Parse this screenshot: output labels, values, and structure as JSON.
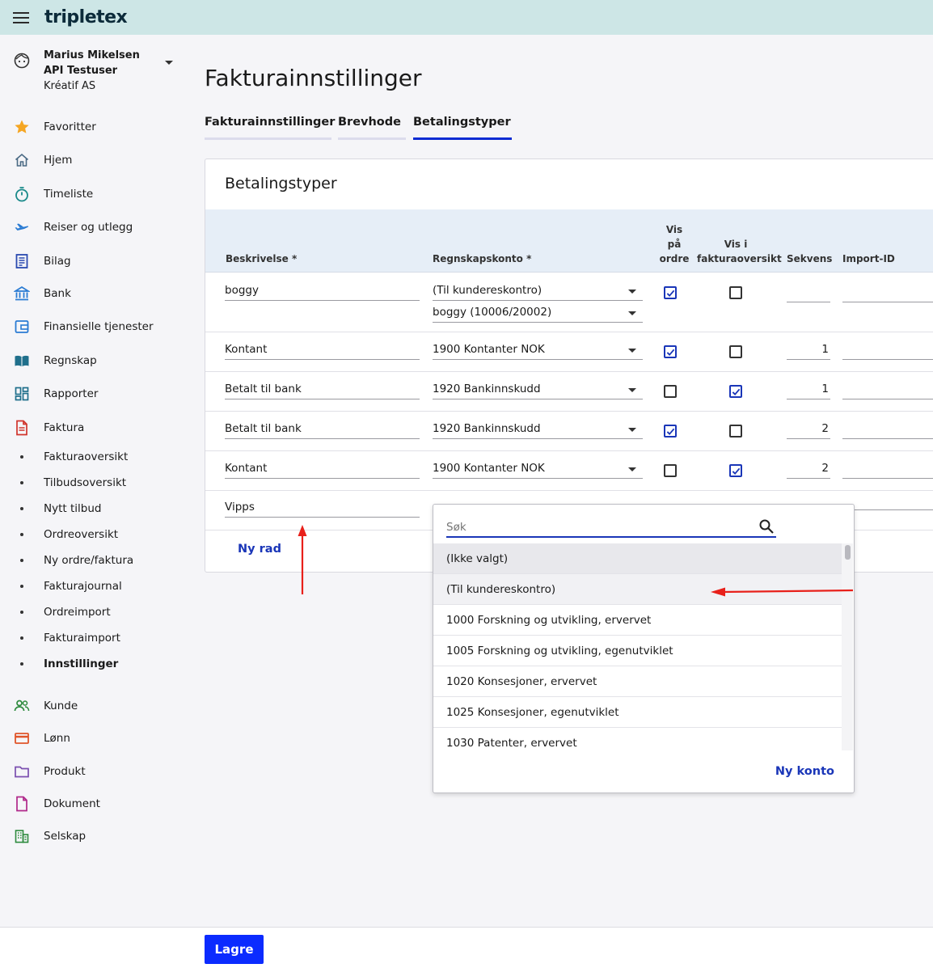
{
  "app": {
    "logo": "tripletex"
  },
  "user": {
    "name": "Marius Mikelsen API Testuser",
    "company": "Kréatif AS"
  },
  "nav": {
    "items": [
      {
        "label": "Favoritter",
        "icon": "star-icon"
      },
      {
        "label": "Hjem",
        "icon": "home-icon"
      },
      {
        "label": "Timeliste",
        "icon": "stopwatch-icon"
      },
      {
        "label": "Reiser og utlegg",
        "icon": "airplane-icon"
      },
      {
        "label": "Bilag",
        "icon": "receipt-icon"
      },
      {
        "label": "Bank",
        "icon": "bank-icon"
      },
      {
        "label": "Finansielle tjenester",
        "icon": "wallet-icon"
      },
      {
        "label": "Regnskap",
        "icon": "book-icon"
      },
      {
        "label": "Rapporter",
        "icon": "dashboard-icon"
      },
      {
        "label": "Faktura",
        "icon": "invoice-icon"
      }
    ],
    "sub_items": [
      {
        "label": "Fakturaoversikt"
      },
      {
        "label": "Tilbudsoversikt"
      },
      {
        "label": "Nytt tilbud"
      },
      {
        "label": "Ordreoversikt"
      },
      {
        "label": "Ny ordre/faktura"
      },
      {
        "label": "Fakturajournal"
      },
      {
        "label": "Ordreimport"
      },
      {
        "label": "Fakturaimport"
      },
      {
        "label": "Innstillinger",
        "active": true
      }
    ],
    "items2": [
      {
        "label": "Kunde",
        "icon": "people-icon"
      },
      {
        "label": "Lønn",
        "icon": "card-icon"
      },
      {
        "label": "Produkt",
        "icon": "folder-icon"
      },
      {
        "label": "Dokument",
        "icon": "document-icon"
      },
      {
        "label": "Selskap",
        "icon": "building-icon"
      }
    ]
  },
  "page": {
    "title": "Fakturainnstillinger",
    "tabs": [
      {
        "label": "Fakturainnstillinger"
      },
      {
        "label": "Brevhode"
      },
      {
        "label": "Betalingstyper",
        "active": true
      }
    ]
  },
  "card": {
    "title": "Betalingstyper",
    "headers": {
      "description": "Beskrivelse *",
      "account": "Regnskapskonto *",
      "show_order": [
        "Vis",
        "på",
        "ordre"
      ],
      "show_invoice": [
        "Vis i",
        "fakturaoversikt"
      ],
      "sequence": "Sekvens",
      "import_id": "Import-ID"
    },
    "rows": [
      {
        "description": "boggy",
        "account": "(Til kundereskontro)",
        "subaccount": "boggy (10006/20002)",
        "show_order": true,
        "show_invoice": false,
        "sequence": ""
      },
      {
        "description": "Kontant",
        "account": "1900 Kontanter NOK",
        "show_order": true,
        "show_invoice": false,
        "sequence": "1"
      },
      {
        "description": "Betalt til bank",
        "account": "1920 Bankinnskudd",
        "show_order": false,
        "show_invoice": true,
        "sequence": "1"
      },
      {
        "description": "Betalt til bank",
        "account": "1920 Bankinnskudd",
        "show_order": true,
        "show_invoice": false,
        "sequence": "2"
      },
      {
        "description": "Kontant",
        "account": "1900 Kontanter NOK",
        "show_order": false,
        "show_invoice": true,
        "sequence": "2"
      },
      {
        "description": "Vipps"
      }
    ],
    "new_row": "Ny rad"
  },
  "dropdown": {
    "search_placeholder": "Søk",
    "options": [
      "(Ikke valgt)",
      "(Til kundereskontro)",
      "1000 Forskning og utvikling, ervervet",
      "1005 Forskning og utvikling, egenutviklet",
      "1020 Konsesjoner, ervervet",
      "1025 Konsesjoner, egenutviklet",
      "1030 Patenter, ervervet"
    ],
    "new_account": "Ny konto"
  },
  "footer": {
    "save": "Lagre"
  },
  "colors": {
    "accent": "#0b2bd3",
    "topbar": "#cde6e6",
    "annotation": "#e8201a"
  }
}
